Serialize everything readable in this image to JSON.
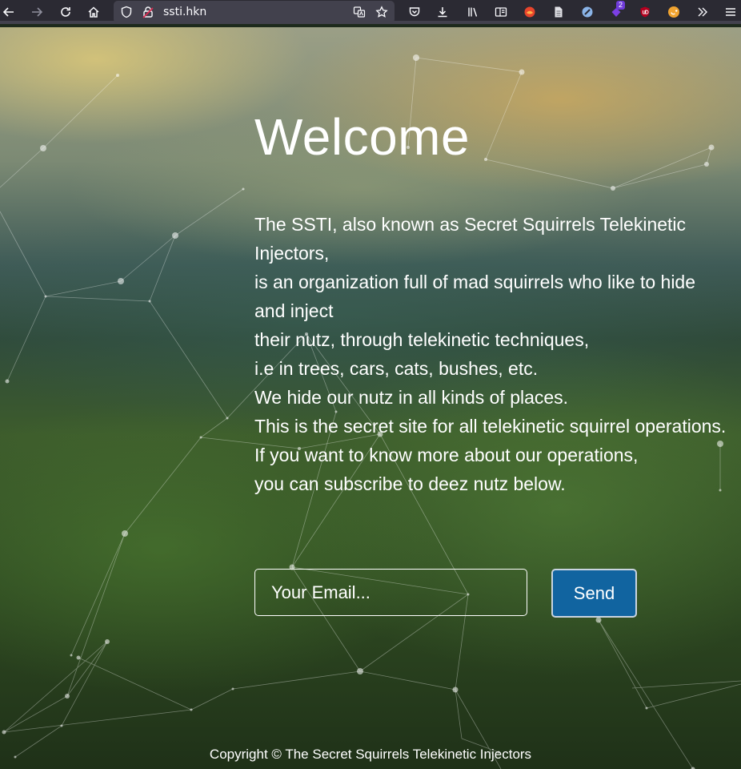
{
  "browser": {
    "url": "ssti.hkn",
    "extension_badge": "2"
  },
  "page": {
    "heading": "Welcome",
    "intro_lines": [
      "The SSTI, also known as Secret Squirrels Telekinetic Injectors,",
      "is an organization full of mad squirrels who like to hide and inject",
      "their nutz, through telekinetic techniques,",
      "i.e in trees, cars, cats, bushes, etc.",
      "We hide our nutz in all kinds of places.",
      "This is the secret site for all telekinetic squirrel operations.",
      "If you want to know more about our operations,",
      "you can subscribe to deez nutz below."
    ],
    "email_placeholder": "Your Email...",
    "send_label": "Send",
    "footer": "Copyright © The Secret Squirrels Telekinetic Injectors"
  }
}
